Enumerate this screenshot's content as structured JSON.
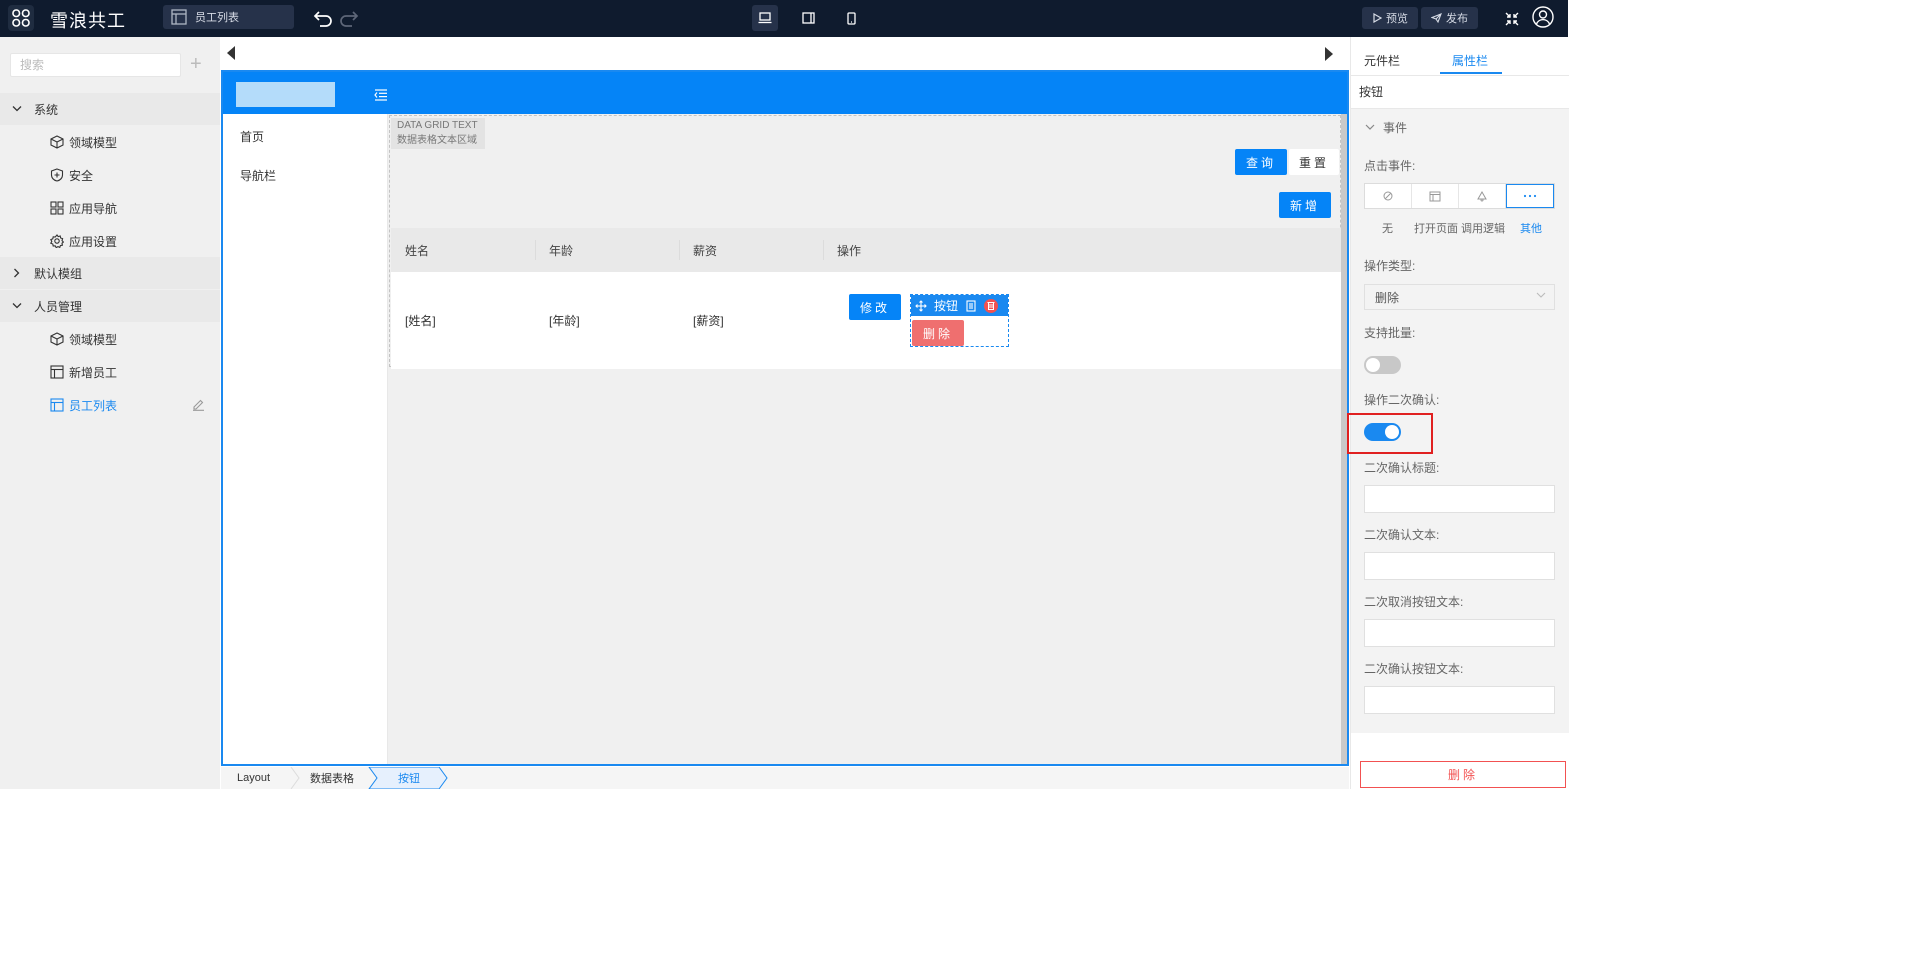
{
  "app": {
    "title": "雪浪共工",
    "current_page": "员工列表"
  },
  "topbar": {
    "devices": [
      "desktop",
      "tablet",
      "mobile"
    ],
    "active_device": "desktop",
    "preview_label": "预览",
    "publish_label": "发布"
  },
  "sidebar": {
    "search_placeholder": "搜索",
    "groups": [
      {
        "label": "系统",
        "expanded": true,
        "items": [
          {
            "label": "领域模型",
            "icon": "cube-icon"
          },
          {
            "label": "安全",
            "icon": "shield-icon"
          },
          {
            "label": "应用导航",
            "icon": "grid-icon"
          },
          {
            "label": "应用设置",
            "icon": "gear-icon"
          }
        ]
      },
      {
        "label": "默认模组",
        "expanded": false,
        "items": []
      },
      {
        "label": "人员管理",
        "expanded": true,
        "items": [
          {
            "label": "领域模型",
            "icon": "cube-icon"
          },
          {
            "label": "新增员工",
            "icon": "layout-icon"
          },
          {
            "label": "员工列表",
            "icon": "layout-icon",
            "active": true
          }
        ]
      }
    ]
  },
  "canvas": {
    "nav_items": [
      "首页",
      "导航栏"
    ],
    "grid_tag_line1": "DATA GRID TEXT",
    "grid_tag_line2": "数据表格文本区域",
    "query_label": "查询",
    "reset_label": "重置",
    "add_label": "新增",
    "columns": [
      "姓名",
      "年龄",
      "薪资",
      "操作"
    ],
    "row": [
      "[姓名]",
      "[年龄]",
      "[薪资]"
    ],
    "edit_label": "修改",
    "selected_component_label": "按钮",
    "delete_row_label": "删除"
  },
  "breadcrumb": [
    "Layout",
    "数据表格",
    "按钮"
  ],
  "right_panel": {
    "tabs": [
      "元件栏",
      "属性栏"
    ],
    "active_tab": "属性栏",
    "component_name": "按钮",
    "section_title": "事件",
    "click_event_label": "点击事件:",
    "event_options": [
      "无",
      "打开页面",
      "调用逻辑",
      "其他"
    ],
    "active_event": "其他",
    "action_type_label": "操作类型:",
    "action_type_value": "删除",
    "batch_label": "支持批量:",
    "batch_enabled": false,
    "confirm_label": "操作二次确认:",
    "confirm_enabled": true,
    "confirm_title_label": "二次确认标题:",
    "confirm_text_label": "二次确认文本:",
    "cancel_btn_text_label": "二次取消按钮文本:",
    "confirm_btn_text_label": "二次确认按钮文本:",
    "delete_label": "删除"
  },
  "colors": {
    "topbar_bg": "#0f1b2e",
    "accent": "#1a89f0",
    "app_header": "#0584f7",
    "danger": "#f25151",
    "highlight_box": "#e02020"
  }
}
